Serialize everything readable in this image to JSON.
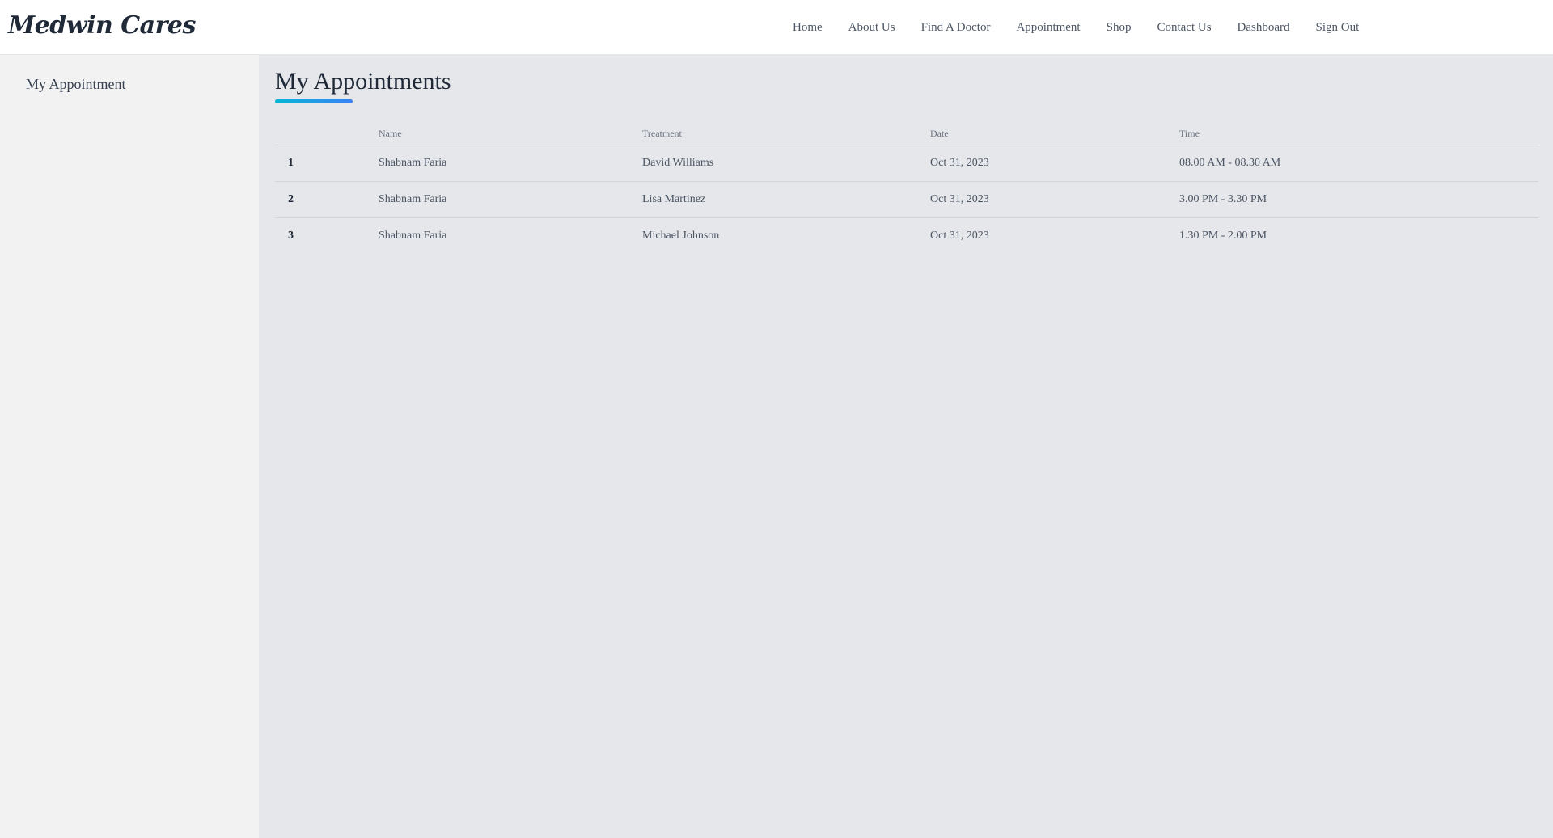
{
  "header": {
    "logo": "Medwin Cares",
    "nav": [
      "Home",
      "About Us",
      "Find A Doctor",
      "Appointment",
      "Shop",
      "Contact Us",
      "Dashboard",
      "Sign Out"
    ]
  },
  "sidebar": {
    "items": [
      {
        "label": "My Appointment"
      }
    ]
  },
  "main": {
    "title": "My Appointments",
    "accent_colors": [
      "#06b6d4",
      "#3b82f6"
    ],
    "table": {
      "columns": [
        "",
        "Name",
        "Treatment",
        "Date",
        "Time"
      ],
      "rows": [
        [
          "1",
          "Shabnam Faria",
          "David Williams",
          "Oct 31, 2023",
          "08.00 AM - 08.30 AM"
        ],
        [
          "2",
          "Shabnam Faria",
          "Lisa Martinez",
          "Oct 31, 2023",
          "3.00 PM - 3.30 PM"
        ],
        [
          "3",
          "Shabnam Faria",
          "Michael Johnson",
          "Oct 31, 2023",
          "1.30 PM - 2.00 PM"
        ]
      ]
    }
  }
}
